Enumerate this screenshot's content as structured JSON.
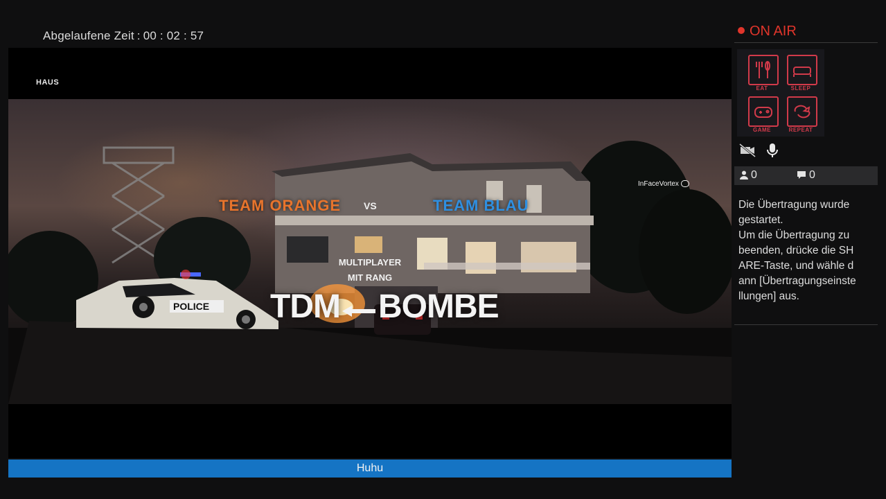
{
  "header": {
    "elapsed_label": "Abgelaufene Zeit",
    "elapsed_time": "00 : 02 : 57"
  },
  "game": {
    "map_name": "HAUS",
    "team_orange": "TEAM ORANGE",
    "vs": "VS",
    "team_blue": "TEAM BLAU",
    "watermark": "InFaceVortex",
    "mode_line1": "MULTIPLAYER",
    "mode_line2": "MIT RANG",
    "title_left": "TDM",
    "title_right": "BOMBE",
    "police_text": "POLICE"
  },
  "status_bar": {
    "text": "Huhu"
  },
  "panel": {
    "onair": "ON AIR",
    "avatar": {
      "eat": "EAT",
      "sleep": "SLEEP",
      "game": "GAME",
      "repeat": "REPEAT"
    },
    "viewers": "0",
    "comments": "0",
    "message": "Die Übertragung wurde gestartet.\nUm die Übertragung zu beenden, drücke die SHARE-Taste, und wähle dann [Übertragungseinstellungen] aus."
  },
  "colors": {
    "accent_blue": "#1574c4",
    "onair_red": "#e0352b",
    "team_orange": "#e8742c",
    "team_blue": "#2f8fe0"
  }
}
